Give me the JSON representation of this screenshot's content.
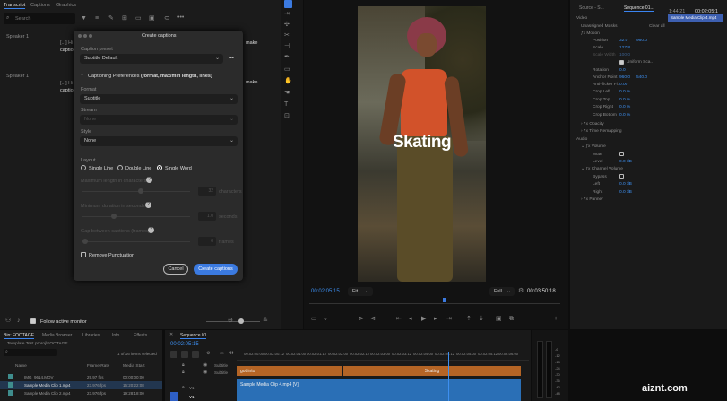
{
  "transcript_panel": {
    "tabs": [
      "Transcript",
      "Captions",
      "Graphics"
    ],
    "search_placeholder": "Search",
    "speaker1a": "Speaker 1",
    "speaker1b": "Speaker 1",
    "snip1": "[...] Hi",
    "snip2": "[...] Hi",
    "snip3": "captions",
    "snip4": "captions",
    "make1": "make",
    "make2": "make"
  },
  "dialog": {
    "title": "Create captions",
    "caption_preset_label": "Caption preset",
    "caption_preset_value": "Subtitle Default",
    "more": "•••",
    "section": "Captioning Preferences",
    "section_sub": "(format, max/min length, lines)",
    "format_label": "Format",
    "format_value": "Subtitle",
    "stream_label": "Stream",
    "stream_value": "None",
    "style_label": "Style",
    "style_value": "None",
    "layout_label": "Layout",
    "single_line": "Single Line",
    "double_line": "Double Line",
    "single_word": "Single Word",
    "max_len_label": "Maximum length in characters",
    "max_len_val": "32",
    "max_len_unit": "characters",
    "min_dur_label": "Minimum duration in seconds",
    "min_dur_val": "1.0",
    "min_dur_unit": "seconds",
    "gap_label": "Gap between captions (frames)",
    "gap_val": "0",
    "gap_unit": "frames",
    "remove_punct": "Remove Punctuation",
    "cancel": "Cancel",
    "create": "Create captions"
  },
  "left_bottom": {
    "follow_label": "Follow active monitor"
  },
  "source_bin": {
    "tabs": [
      "Bin: FOOTAGE",
      "Media Browser",
      "Libraries",
      "Info",
      "Effects"
    ],
    "path": "Template Test.prproj\\FOOTAGE",
    "count": "1 of 16 items selected",
    "cols": [
      "Name",
      "Frame Rate",
      "Media Start"
    ],
    "rows": [
      {
        "name": "IMG_9614.MOV",
        "rate": "29.97 fps",
        "start": "00:00:00:00"
      },
      {
        "name": "Sample Media Clip 1.mp4",
        "rate": "23.976 fps",
        "start": "16:20:22:08"
      },
      {
        "name": "Sample Media Clip 2.mp4",
        "rate": "23.976 fps",
        "start": "19:28:18:00"
      }
    ]
  },
  "program": {
    "caption": "Skating",
    "timecode_left": "00:02:05:15",
    "fit": "Fit",
    "full": "Full",
    "timecode_right": "00:03:50:18"
  },
  "timeline": {
    "tab": "Sequence 01",
    "timecode": "00:02:05:15",
    "ruler": [
      "00:02:00:00",
      "00:02:00:12",
      "00:02:01:00",
      "00:02:01:12",
      "00:02:02:00",
      "00:02:02:12",
      "00:02:03:00",
      "00:02:03:12",
      "00:02:04:00",
      "00:02:04:12",
      "00:02:05:00",
      "00:02:05:12",
      "00:02:06:00",
      "00:02:06:12"
    ],
    "sub1": "Subtitle",
    "sub2": "Subtitle",
    "clip_a": "got into",
    "clip_b": "Skating",
    "video_clip": "Sample Media Clip 4.mp4 [V]",
    "v1": "V1",
    "a1": "V1"
  },
  "effect_controls": {
    "source_tab": "Source - S...",
    "seq_tab": "Sequence 01...",
    "clip_badge": "Sample Media Clip 4.mp4",
    "time1": "1:44:21",
    "time2": "00:02:05:1",
    "video": "Video",
    "unassigned": "Unassigned Masks",
    "clear_all": "Clear all",
    "motion": "Motion",
    "position": "Position",
    "pos_x": "32.0",
    "pos_y": "960.0",
    "scale": "Scale",
    "scale_v": "127.8",
    "scale_width": "Scale Width",
    "scale_width_v": "100.0",
    "uniform": "Uniform Sca..",
    "rotation": "Rotation",
    "rotation_v": "0.0",
    "anchor": "Anchor Point",
    "anchor_x": "960.0",
    "anchor_y": "540.0",
    "antiflicker": "Anti-flicker Fi..",
    "antiflicker_v": "0.00",
    "crop_left": "Crop Left",
    "crop_left_v": "0.0 %",
    "crop_top": "Crop Top",
    "crop_top_v": "0.0 %",
    "crop_right": "Crop Right",
    "crop_right_v": "0.0 %",
    "crop_bottom": "Crop Bottom",
    "crop_bottom_v": "0.0 %",
    "opacity": "Opacity",
    "time_remap": "Time Remapping",
    "audio": "Audio",
    "volume": "Volume",
    "mute": "Mute",
    "level": "Level",
    "level_v": "0.0 dB",
    "channel_volume": "Channel Volume",
    "bypass": "Bypass",
    "left": "Left",
    "left_v": "0.0 dB",
    "right": "Right",
    "right_v": "0.0 dB",
    "panner": "Panner"
  },
  "meter": {
    "ticks": [
      "-6",
      "-12",
      "-18",
      "-24",
      "-30",
      "-36",
      "-42",
      "-48",
      "-54"
    ]
  },
  "watermark": "aiznt.com"
}
